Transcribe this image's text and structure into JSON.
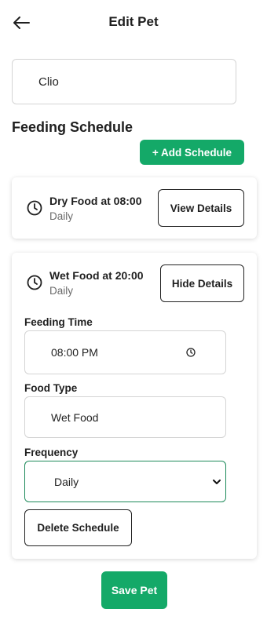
{
  "header": {
    "title": "Edit Pet",
    "back_icon": "arrow-left-icon"
  },
  "pet": {
    "name": "Clio"
  },
  "section": {
    "title": "Feeding Schedule",
    "add_label": "+ Add Schedule"
  },
  "schedules": [
    {
      "title": "Dry Food at 08:00",
      "frequency": "Daily",
      "toggle_label": "View Details",
      "expanded": false
    },
    {
      "title": "Wet Food at 20:00",
      "frequency": "Daily",
      "toggle_label": "Hide Details",
      "expanded": true,
      "fields": {
        "time_label": "Feeding Time",
        "time_value": "08:00 PM",
        "food_label": "Food Type",
        "food_value": "Wet Food",
        "frequency_label": "Frequency",
        "frequency_value": "Daily"
      },
      "delete_label": "Delete Schedule"
    }
  ],
  "footer": {
    "save_label": "Save Pet"
  },
  "colors": {
    "accent": "#14a968",
    "select_border": "#1d8a5a",
    "muted_text": "#6b6b6b"
  }
}
